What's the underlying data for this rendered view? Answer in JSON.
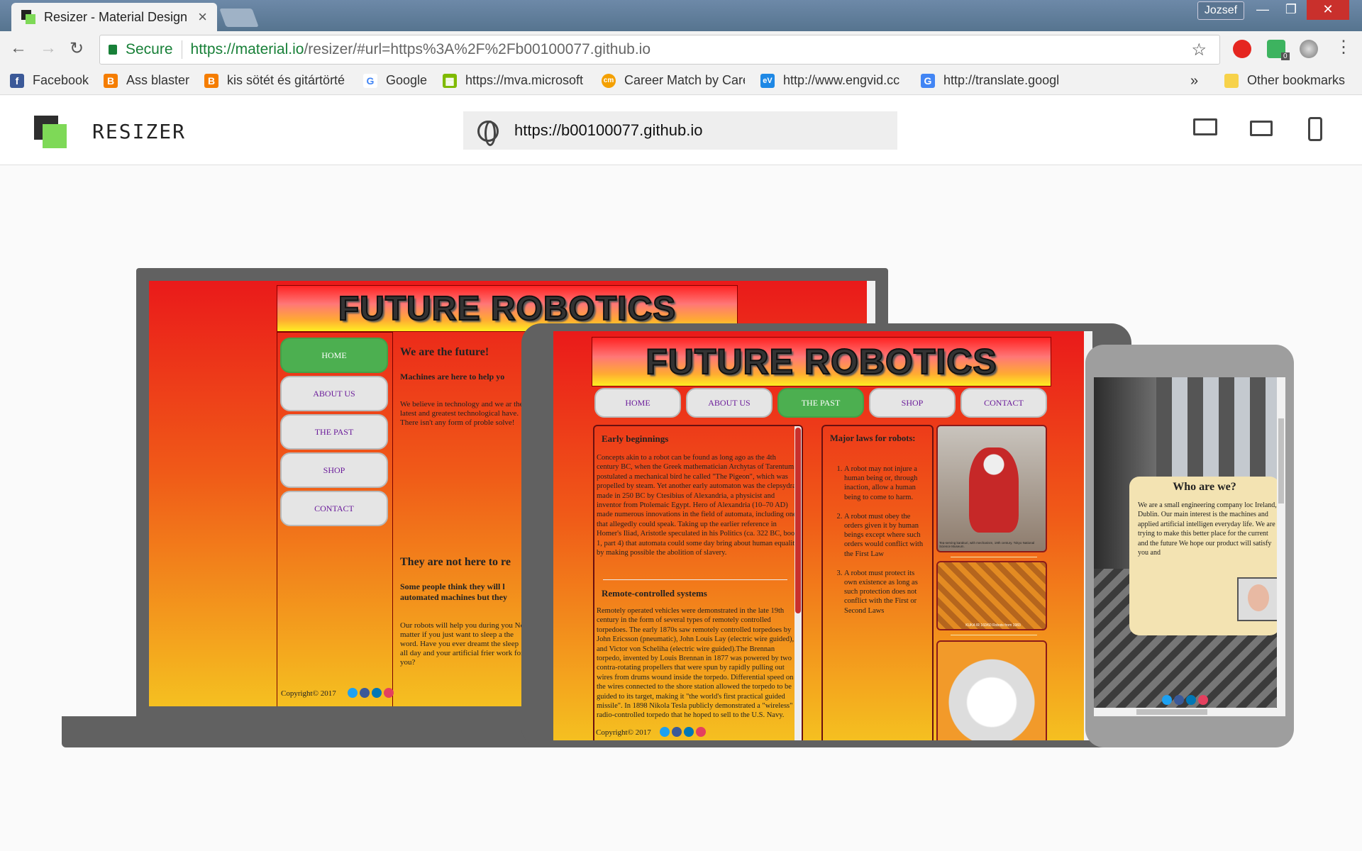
{
  "browser": {
    "tab_title": "Resizer - Material Design",
    "tab_close": "×",
    "user": "Jozsef",
    "window_controls": [
      "—",
      "❐",
      "✕"
    ],
    "back": "←",
    "forward": "→",
    "reload": "↻",
    "secure_label": "Secure",
    "url_host": "https://material.io",
    "url_path": "/resizer/#url=https%3A%2F%2Fb00100077.github.io",
    "star": "☆",
    "menu": "⋮",
    "ext_badge": "0"
  },
  "bookmarks": [
    {
      "label": "Facebook",
      "icon": "facebook-icon",
      "color": "#3b5998",
      "glyph": "f"
    },
    {
      "label": "Ass blaster",
      "icon": "blogger-icon",
      "color": "#f57d00",
      "glyph": "B"
    },
    {
      "label": "kis sötét és gitártörté",
      "icon": "blogger-icon",
      "color": "#f57d00",
      "glyph": "B"
    },
    {
      "label": "Google",
      "icon": "google-icon",
      "color": "#4285f4",
      "glyph": "G"
    },
    {
      "label": "https://mva.microsoft",
      "icon": "microsoft-icon",
      "color": "#7fba00",
      "glyph": "▦"
    },
    {
      "label": "Career Match by Care",
      "icon": "careermatch-icon",
      "color": "#f4a000",
      "glyph": "cm"
    },
    {
      "label": "http://www.engvid.cc",
      "icon": "engvid-icon",
      "color": "#1e88e5",
      "glyph": "eV"
    },
    {
      "label": "http://translate.googl",
      "icon": "translate-icon",
      "color": "#4285f4",
      "glyph": "G"
    }
  ],
  "bookmarks_more": "»",
  "other_bookmarks": "Other bookmarks",
  "resizer": {
    "brand": "RESIZER",
    "url": "https://b00100077.github.io"
  },
  "site": {
    "title": "FUTURE ROBOTICS",
    "nav": [
      "HOME",
      "ABOUT US",
      "THE PAST",
      "SHOP",
      "CONTACT"
    ],
    "home": {
      "heading1": "We are the future!",
      "sub1": "Machines are here to help yo",
      "body1": "We believe in technology and we ar the latest and greatest technological have. There isn't any form of proble solve!",
      "heading2": "They are not here to re",
      "sub2": "Some people think they will l automated machines but they",
      "body2": "Our robots will help you during you No matter if you just want to sleep a the word. Have you ever dreamt the sleep all day and your artificial frier work for you?",
      "copyright": "Copyright© 2017"
    },
    "past": {
      "h_early": "Early beginnings",
      "p_early": "Concepts akin to a robot can be found as long ago as the 4th century BC, when the Greek mathematician Archytas of Tarentum postulated a mechanical bird he called \"The Pigeon\", which was propelled by steam. Yet another early automaton was the clepsydra, made in 250 BC by Ctesibius of Alexandria, a physicist and inventor from Ptolemaic Egypt. Hero of Alexandria (10–70 AD) made numerous innovations in the field of automata, including one that allegedly could speak. Taking up the earlier reference in Homer's Iliad, Aristotle speculated in his Politics (ca. 322 BC, book 1, part 4) that automata could some day bring about human equality by making possible the abolition of slavery.",
      "h_remote": "Remote-controlled systems",
      "p_remote": "Remotely operated vehicles were demonstrated in the late 19th century in the form of several types of remotely controlled torpedoes. The early 1870s saw remotely controlled torpedoes by John Ericsson (pneumatic), John Louis Lay (electric wire guided), and Victor von Scheliha (electric wire guided).The Brennan torpedo, invented by Louis Brennan in 1877 was powered by two contra-rotating propellers that were spun by rapidly pulling out wires from drums wound inside the torpedo. Differential speed on the wires connected to the shore station allowed the torpedo to be guided to its target, making it \"the world's first practical guided missile\". In 1898 Nikola Tesla publicly demonstrated a \"wireless\" radio-controlled torpedo that he hoped to sell to the U.S. Navy.",
      "copyright": "Copyright© 2017",
      "laws_title": "Major laws for robots:",
      "laws": [
        "A robot may not injure a human being or, through inaction, allow a human being to come to harm.",
        "A robot must obey the orders given it by human beings except where such orders would conflict with the First Law",
        "A robot must protect its own existence as long as such protection does not conflict with the First or Second Laws"
      ],
      "caption1": "Tea-serving karakuri, with mechanism, 19th century. Tokyo National Science Museum.",
      "caption2": "KUKA IR 160/60 Robots from 1983"
    },
    "about": {
      "heading": "Who are we?",
      "body": "We are a small engineering company loc Ireland, Dublin. Our main interest is the machines and applied artificial intelligen everyday life. We are trying to make this better place for the current and the future We hope our product will satisfy you and"
    }
  },
  "colors": {
    "accent_green": "#4caf50",
    "nav_text": "#6a1b9a",
    "device_frame": "#616161"
  }
}
